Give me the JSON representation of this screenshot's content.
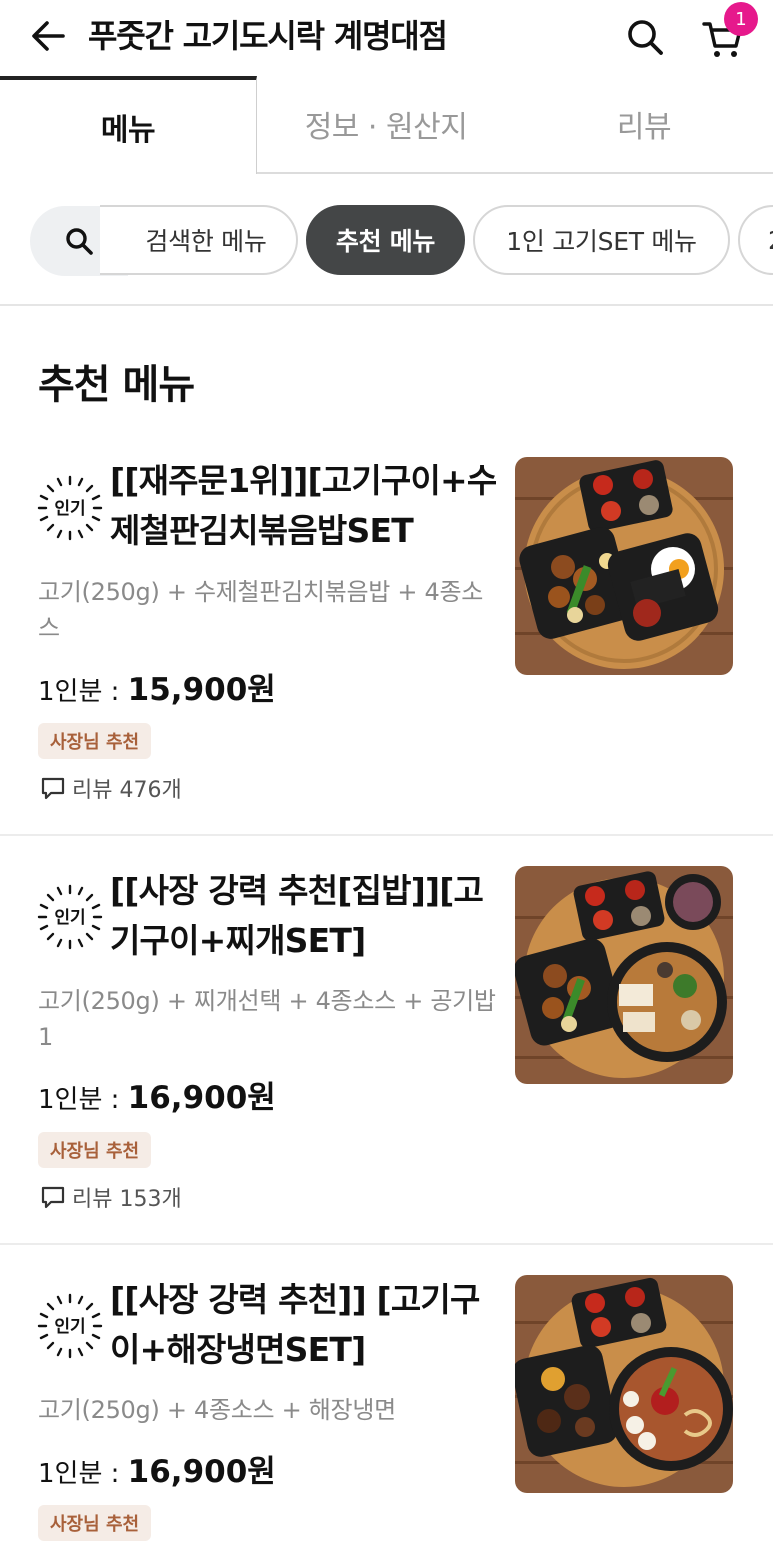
{
  "header": {
    "title": "푸줏간 고기도시락 계명대점",
    "cart_count": "1"
  },
  "tabs": [
    {
      "label": "메뉴"
    },
    {
      "label": "정보 · 원산지"
    },
    {
      "label": "리뷰"
    }
  ],
  "chips": [
    {
      "label": "검색한 메뉴"
    },
    {
      "label": "추천 메뉴"
    },
    {
      "label": "1인 고기SET 메뉴"
    },
    {
      "label": "2"
    }
  ],
  "section": {
    "title": "추천 메뉴"
  },
  "popular_badge": "인기",
  "items": [
    {
      "name": "[[재주문1위]][고기구이+수제철판김치볶음밥SET",
      "description": "고기(250g) + 수제철판김치볶음밥 + 4종소스",
      "price_label": "1인분 : ",
      "price": "15,900원",
      "badge": "사장님 추천",
      "review": "리뷰 476개"
    },
    {
      "name": "[[사장 강력 추천[집밥]][고기구이+찌개SET]",
      "description": "고기(250g) + 찌개선택 + 4종소스 + 공기밥1",
      "price_label": "1인분 : ",
      "price": "16,900원",
      "badge": "사장님 추천",
      "review": "리뷰 153개"
    },
    {
      "name": "[[사장 강력 추천]] [고기구이+해장냉면SET]",
      "description": "고기(250g) + 4종소스 + 해장냉면",
      "price_label": "1인분 : ",
      "price": "16,900원",
      "badge": "사장님 추천"
    }
  ]
}
